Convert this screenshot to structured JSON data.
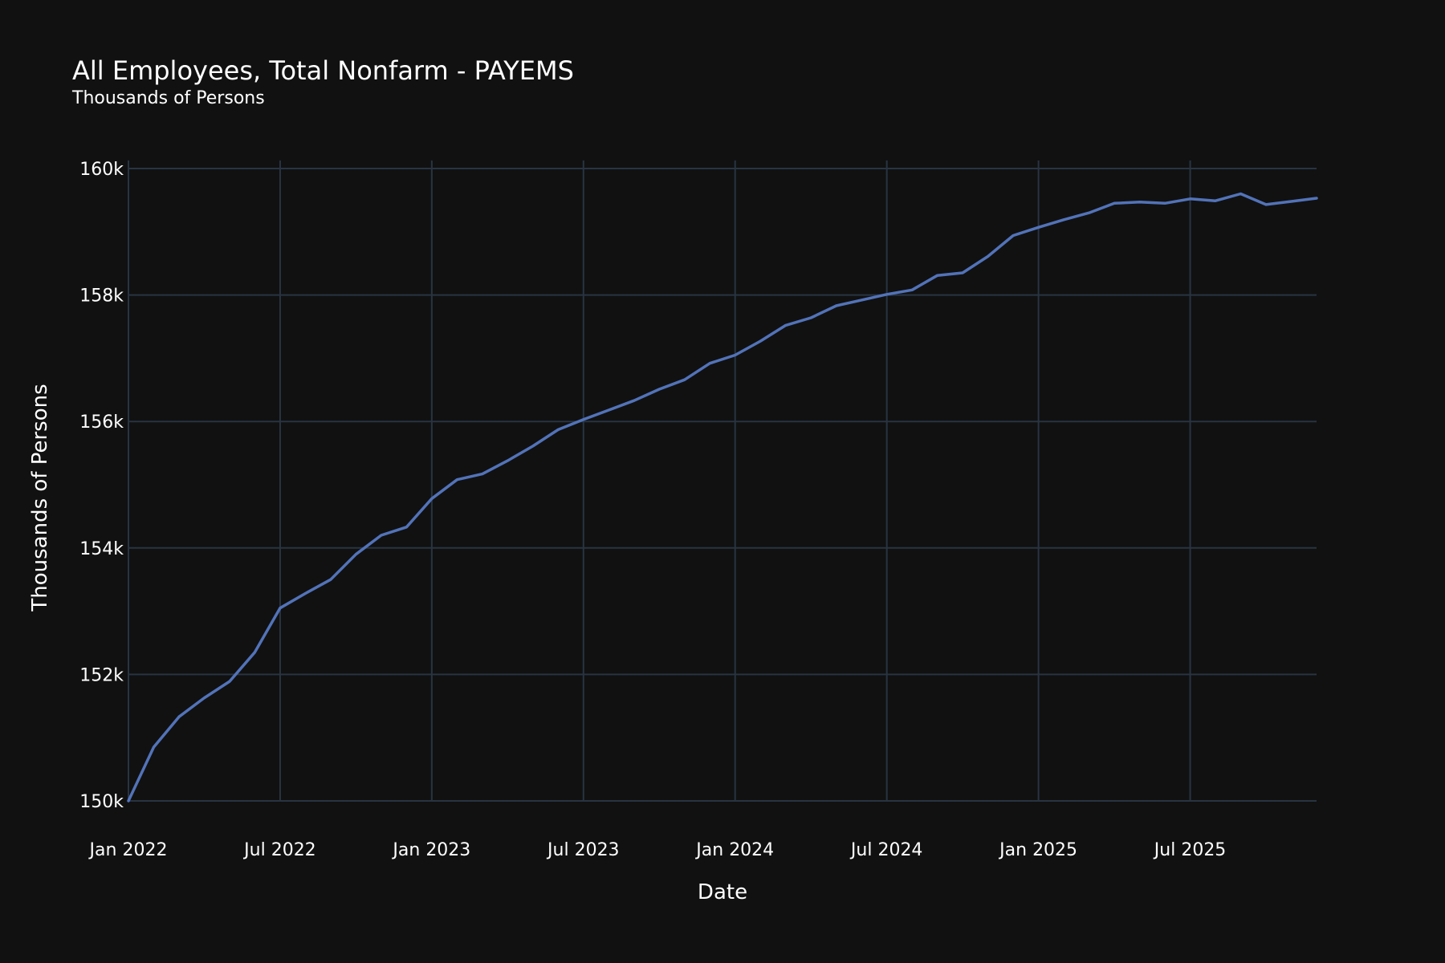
{
  "chart_data": {
    "type": "line",
    "title": "All Employees, Total Nonfarm - PAYEMS",
    "subtitle": "Thousands of Persons",
    "xlabel": "Date",
    "ylabel": "Thousands of Persons",
    "ylim": [
      150000,
      160000
    ],
    "y_ticks": [
      {
        "value": 150000,
        "label": "150k"
      },
      {
        "value": 152000,
        "label": "152k"
      },
      {
        "value": 154000,
        "label": "154k"
      },
      {
        "value": 156000,
        "label": "156k"
      },
      {
        "value": 158000,
        "label": "158k"
      },
      {
        "value": 160000,
        "label": "160k"
      }
    ],
    "x_range": [
      "2022-01",
      "2025-12"
    ],
    "x_ticks": [
      {
        "value": "2022-01",
        "label": "Jan 2022"
      },
      {
        "value": "2022-07",
        "label": "Jul 2022"
      },
      {
        "value": "2023-01",
        "label": "Jan 2023"
      },
      {
        "value": "2023-07",
        "label": "Jul 2023"
      },
      {
        "value": "2024-01",
        "label": "Jan 2024"
      },
      {
        "value": "2024-07",
        "label": "Jul 2024"
      },
      {
        "value": "2025-01",
        "label": "Jan 2025"
      },
      {
        "value": "2025-07",
        "label": "Jul 2025"
      }
    ],
    "grid": true,
    "colors": {
      "background": "#111111",
      "grid": "#283442",
      "line": "#5273b9",
      "text": "#ffffff"
    },
    "series": [
      {
        "color": "#5273b9",
        "x": [
          "2022-01",
          "2022-02",
          "2022-03",
          "2022-04",
          "2022-05",
          "2022-06",
          "2022-07",
          "2022-08",
          "2022-09",
          "2022-10",
          "2022-11",
          "2022-12",
          "2023-01",
          "2023-02",
          "2023-03",
          "2023-04",
          "2023-05",
          "2023-06",
          "2023-07",
          "2023-08",
          "2023-09",
          "2023-10",
          "2023-11",
          "2023-12",
          "2024-01",
          "2024-02",
          "2024-03",
          "2024-04",
          "2024-05",
          "2024-06",
          "2024-07",
          "2024-08",
          "2024-09",
          "2024-10",
          "2024-11",
          "2024-12",
          "2025-01",
          "2025-02",
          "2025-03",
          "2025-04",
          "2025-05",
          "2025-06",
          "2025-07",
          "2025-08",
          "2025-09",
          "2025-10",
          "2025-11",
          "2025-12"
        ],
        "values": [
          150000,
          150850,
          151330,
          151630,
          151890,
          152350,
          153050,
          153280,
          153500,
          153900,
          154200,
          154330,
          154780,
          155080,
          155170,
          155380,
          155610,
          155870,
          156030,
          156180,
          156330,
          156510,
          156660,
          156920,
          157050,
          157270,
          157520,
          157640,
          157830,
          157920,
          158010,
          158080,
          158310,
          158350,
          158610,
          158940,
          159070,
          159190,
          159300,
          159450,
          159470,
          159450,
          159520,
          159490,
          159600,
          159430,
          159480,
          159530
        ]
      }
    ]
  }
}
